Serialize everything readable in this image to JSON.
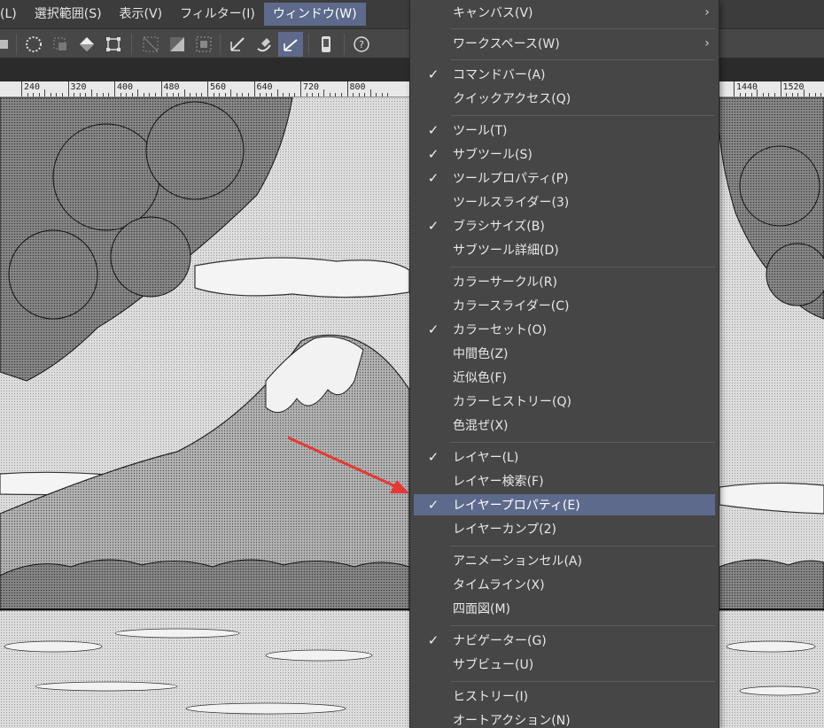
{
  "menubar": {
    "items": [
      {
        "label": "(L)"
      },
      {
        "label": "選択範囲(S)"
      },
      {
        "label": "表示(V)"
      },
      {
        "label": "フィルター(I)"
      },
      {
        "label": "ウィンドウ(W)"
      }
    ],
    "active_index": 4
  },
  "ruler_left": {
    "labels": [
      "240",
      "320",
      "400",
      "480",
      "560",
      "640",
      "720",
      "800"
    ]
  },
  "ruler_right": {
    "labels": [
      "1440",
      "1520"
    ]
  },
  "window_menu": {
    "items": [
      {
        "label": "キャンバス(V)",
        "checked": false,
        "submenu": true
      },
      {
        "label": "ワークスペース(W)",
        "checked": false,
        "submenu": true
      },
      {
        "label": "コマンドバー(A)",
        "checked": true
      },
      {
        "label": "クイックアクセス(Q)",
        "checked": false
      },
      {
        "label": "ツール(T)",
        "checked": true
      },
      {
        "label": "サブツール(S)",
        "checked": true
      },
      {
        "label": "ツールプロパティ(P)",
        "checked": true
      },
      {
        "label": "ツールスライダー(3)",
        "checked": false
      },
      {
        "label": "ブラシサイズ(B)",
        "checked": true
      },
      {
        "label": "サブツール詳細(D)",
        "checked": false
      },
      {
        "label": "カラーサークル(R)",
        "checked": false
      },
      {
        "label": "カラースライダー(C)",
        "checked": false
      },
      {
        "label": "カラーセット(O)",
        "checked": true
      },
      {
        "label": "中間色(Z)",
        "checked": false
      },
      {
        "label": "近似色(F)",
        "checked": false
      },
      {
        "label": "カラーヒストリー(Q)",
        "checked": false
      },
      {
        "label": "色混ぜ(X)",
        "checked": false
      },
      {
        "label": "レイヤー(L)",
        "checked": true
      },
      {
        "label": "レイヤー検索(F)",
        "checked": false
      },
      {
        "label": "レイヤープロパティ(E)",
        "checked": true,
        "highlighted": true
      },
      {
        "label": "レイヤーカンプ(2)",
        "checked": false
      },
      {
        "label": "アニメーションセル(A)",
        "checked": false
      },
      {
        "label": "タイムライン(X)",
        "checked": false
      },
      {
        "label": "四面図(M)",
        "checked": false
      },
      {
        "label": "ナビゲーター(G)",
        "checked": true
      },
      {
        "label": "サブビュー(U)",
        "checked": false
      },
      {
        "label": "ヒストリー(I)",
        "checked": false
      },
      {
        "label": "オートアクション(N)",
        "checked": false
      }
    ],
    "check_glyph": "✓",
    "arrow_glyph": "›"
  },
  "colors": {
    "accent": "#5d6a8c",
    "annotation_arrow": "#e53935"
  }
}
